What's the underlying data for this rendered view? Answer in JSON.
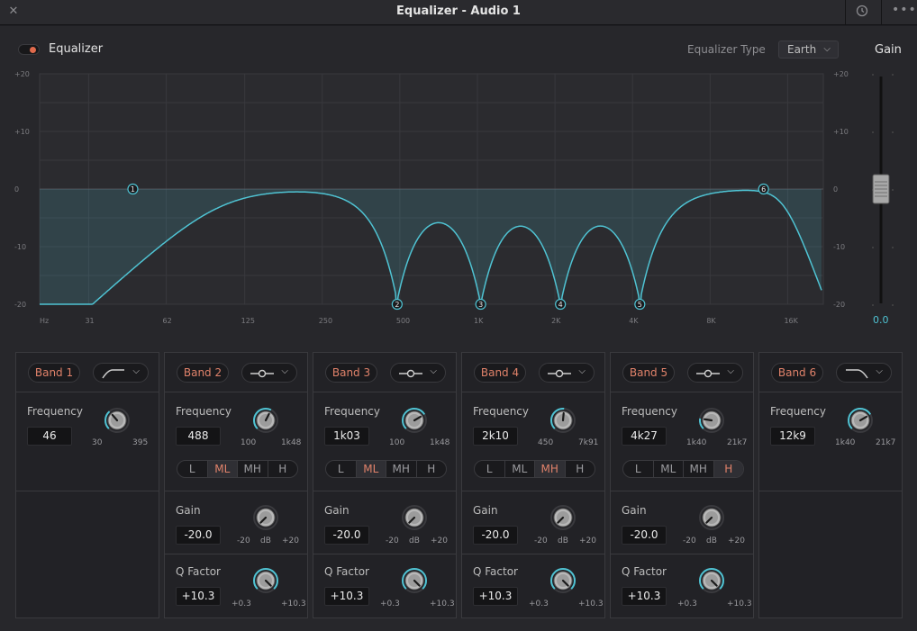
{
  "window": {
    "title": "Equalizer - Audio 1"
  },
  "header": {
    "toggle_label": "Equalizer",
    "eq_type_label": "Equalizer Type",
    "eq_type_value": "Earth",
    "gain_label": "Gain",
    "gain_value": "0.0"
  },
  "colors": {
    "curve": "#4fc3d3",
    "band_label": "#e0826a",
    "accent": "#4fc3d3"
  },
  "chart_data": {
    "type": "line",
    "x_axis": {
      "unit": "Hz",
      "ticks": [
        "Hz",
        "31",
        "62",
        "125",
        "250",
        "500",
        "1K",
        "2K",
        "4K",
        "8K",
        "16K"
      ]
    },
    "y_axis": {
      "ticks": [
        "+20",
        "+10",
        "0",
        "-10",
        "-20"
      ],
      "ylim": [
        -20,
        20
      ]
    },
    "grid": true,
    "band_markers": [
      {
        "label": "1",
        "freq_hz": 46,
        "gain_db": 0
      },
      {
        "label": "2",
        "freq_hz": 488,
        "gain_db": -20
      },
      {
        "label": "3",
        "freq_hz": 1030,
        "gain_db": -20
      },
      {
        "label": "4",
        "freq_hz": 2100,
        "gain_db": -20
      },
      {
        "label": "5",
        "freq_hz": 4270,
        "gain_db": -20
      },
      {
        "label": "6",
        "freq_hz": 12900,
        "gain_db": 0
      }
    ]
  },
  "bands": [
    {
      "name": "Band 1",
      "filter": "highpass",
      "frequency": {
        "label": "Frequency",
        "value": "46",
        "min": "30",
        "max": "395",
        "level": 0.35
      }
    },
    {
      "name": "Band 2",
      "filter": "bell",
      "frequency": {
        "label": "Frequency",
        "value": "488",
        "min": "100",
        "max": "1k48",
        "level": 0.6
      },
      "ranges": [
        "L",
        "ML",
        "MH",
        "H"
      ],
      "active_range": "ML",
      "gain": {
        "label": "Gain",
        "value": "-20.0",
        "min": "-20",
        "unit": "dB",
        "max": "+20",
        "level": 0.0
      },
      "q": {
        "label": "Q Factor",
        "value": "+10.3",
        "min": "+0.3",
        "max": "+10.3",
        "level": 1.0
      }
    },
    {
      "name": "Band 3",
      "filter": "bell",
      "frequency": {
        "label": "Frequency",
        "value": "1k03",
        "min": "100",
        "max": "1k48",
        "level": 0.72
      },
      "ranges": [
        "L",
        "ML",
        "MH",
        "H"
      ],
      "active_range": "ML",
      "gain": {
        "label": "Gain",
        "value": "-20.0",
        "min": "-20",
        "unit": "dB",
        "max": "+20",
        "level": 0.0
      },
      "q": {
        "label": "Q Factor",
        "value": "+10.3",
        "min": "+0.3",
        "max": "+10.3",
        "level": 1.0
      }
    },
    {
      "name": "Band 4",
      "filter": "bell",
      "frequency": {
        "label": "Frequency",
        "value": "2k10",
        "min": "450",
        "max": "7k91",
        "level": 0.52
      },
      "ranges": [
        "L",
        "ML",
        "MH",
        "H"
      ],
      "active_range": "MH",
      "gain": {
        "label": "Gain",
        "value": "-20.0",
        "min": "-20",
        "unit": "dB",
        "max": "+20",
        "level": 0.0
      },
      "q": {
        "label": "Q Factor",
        "value": "+10.3",
        "min": "+0.3",
        "max": "+10.3",
        "level": 1.0
      }
    },
    {
      "name": "Band 5",
      "filter": "bell",
      "frequency": {
        "label": "Frequency",
        "value": "4k27",
        "min": "1k40",
        "max": "21k7",
        "level": 0.2
      },
      "ranges": [
        "L",
        "ML",
        "MH",
        "H"
      ],
      "active_range": "H",
      "gain": {
        "label": "Gain",
        "value": "-20.0",
        "min": "-20",
        "unit": "dB",
        "max": "+20",
        "level": 0.0
      },
      "q": {
        "label": "Q Factor",
        "value": "+10.3",
        "min": "+0.3",
        "max": "+10.3",
        "level": 1.0
      }
    },
    {
      "name": "Band 6",
      "filter": "lowpass",
      "frequency": {
        "label": "Frequency",
        "value": "12k9",
        "min": "1k40",
        "max": "21k7",
        "level": 0.72
      }
    }
  ]
}
